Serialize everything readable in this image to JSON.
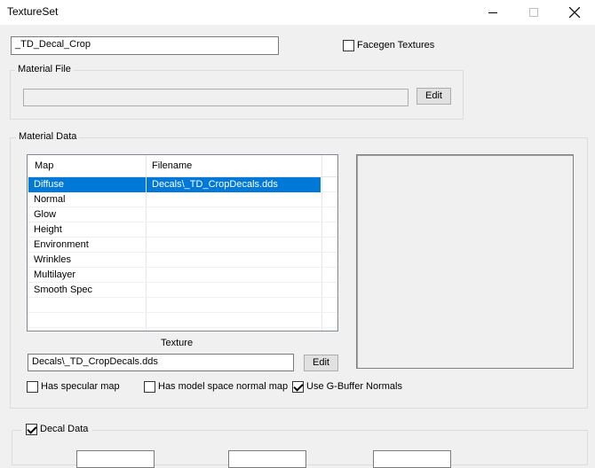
{
  "window": {
    "title": "TextureSet"
  },
  "name_field": {
    "value": "_TD_Decal_Crop"
  },
  "facegen": {
    "label": "Facegen Textures",
    "checked": false
  },
  "material_file": {
    "legend": "Material File",
    "value": "",
    "edit_label": "Edit"
  },
  "material_data": {
    "legend": "Material Data",
    "columns": [
      "Map",
      "Filename"
    ],
    "rows": [
      {
        "map": "Diffuse",
        "filename": "Decals\\_TD_CropDecals.dds",
        "selected": true
      },
      {
        "map": "Normal",
        "filename": ""
      },
      {
        "map": "Glow",
        "filename": ""
      },
      {
        "map": "Height",
        "filename": ""
      },
      {
        "map": "Environment",
        "filename": ""
      },
      {
        "map": "Wrinkles",
        "filename": ""
      },
      {
        "map": "Multilayer",
        "filename": ""
      },
      {
        "map": "Smooth Spec",
        "filename": ""
      }
    ],
    "texture_label": "Texture",
    "texture_value": "Decals\\_TD_CropDecals.dds",
    "texture_edit_label": "Edit",
    "has_specular_label": "Has specular map",
    "has_specular_checked": false,
    "has_model_space_label": "Has model space normal map",
    "has_model_space_checked": false,
    "use_gbuffer_label": "Use G-Buffer Normals",
    "use_gbuffer_checked": true
  },
  "decal_data": {
    "label": "Decal Data",
    "checked": true
  }
}
